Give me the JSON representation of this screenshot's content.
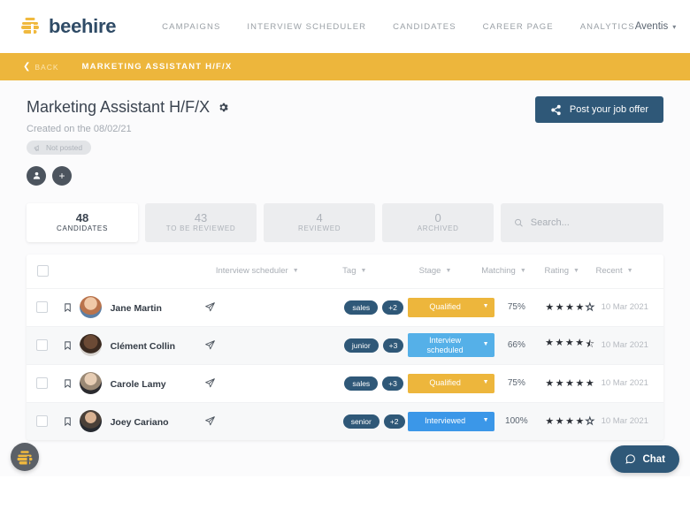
{
  "nav": {
    "brand": "beehire",
    "links": [
      "CAMPAIGNS",
      "INTERVIEW SCHEDULER",
      "CANDIDATES",
      "CAREER PAGE",
      "ANALYTICS"
    ],
    "account": "Aventis",
    "account_caret": "▾"
  },
  "breadcrumb": {
    "back": "BACK",
    "back_chevron": "❮",
    "title": "MARKETING ASSISTANT H/F/X"
  },
  "header": {
    "title": "Marketing Assistant H/F/X",
    "created": "Created on the 08/02/21",
    "status_badge": "Not posted",
    "post_button": "Post your job offer",
    "avatar_user": "●",
    "avatar_add": "+"
  },
  "stats": [
    {
      "value": "48",
      "label": "CANDIDATES",
      "active": true
    },
    {
      "value": "43",
      "label": "TO BE REVIEWED",
      "active": false
    },
    {
      "value": "4",
      "label": "REVIEWED",
      "active": false
    },
    {
      "value": "0",
      "label": "ARCHIVED",
      "active": false
    }
  ],
  "search": {
    "placeholder": "Search...",
    "value": ""
  },
  "table": {
    "columns": [
      {
        "label": "Interview scheduler",
        "caret": "▼"
      },
      {
        "label": "Tag",
        "caret": "▼"
      },
      {
        "label": "Stage",
        "caret": "▼"
      },
      {
        "label": "Matching",
        "caret": "▼"
      },
      {
        "label": "Rating",
        "caret": "▼"
      },
      {
        "label": "Recent",
        "caret": "▼"
      }
    ],
    "rows": [
      {
        "name": "Jane Martin",
        "tags": [
          "sales",
          "+2"
        ],
        "stage": "Qualified",
        "stage_color": "#EDB63C",
        "matching": "75%",
        "rating": 4,
        "rating_half": false,
        "date": "10 Mar 2021"
      },
      {
        "name": "Clément Collin",
        "tags": [
          "junior",
          "+3"
        ],
        "stage": "Interview scheduled",
        "stage_color": "#55B0E8",
        "matching": "66%",
        "rating": 4,
        "rating_half": true,
        "date": "10 Mar 2021"
      },
      {
        "name": "Carole Lamy",
        "tags": [
          "sales",
          "+3"
        ],
        "stage": "Qualified",
        "stage_color": "#EDB63C",
        "matching": "75%",
        "rating": 5,
        "rating_half": false,
        "date": "10 Mar 2021"
      },
      {
        "name": "Joey Cariano",
        "tags": [
          "senior",
          "+2"
        ],
        "stage": "Interviewed",
        "stage_color": "#3B97E8",
        "matching": "100%",
        "rating": 4,
        "rating_half": false,
        "date": "10 Mar 2021"
      }
    ]
  },
  "chat": {
    "label": "Chat"
  },
  "colors": {
    "accent_yellow": "#EDB63C",
    "brand_navy": "#2F5878",
    "stage_blue": "#55B0E8",
    "stage_blue_dark": "#3B97E8"
  }
}
